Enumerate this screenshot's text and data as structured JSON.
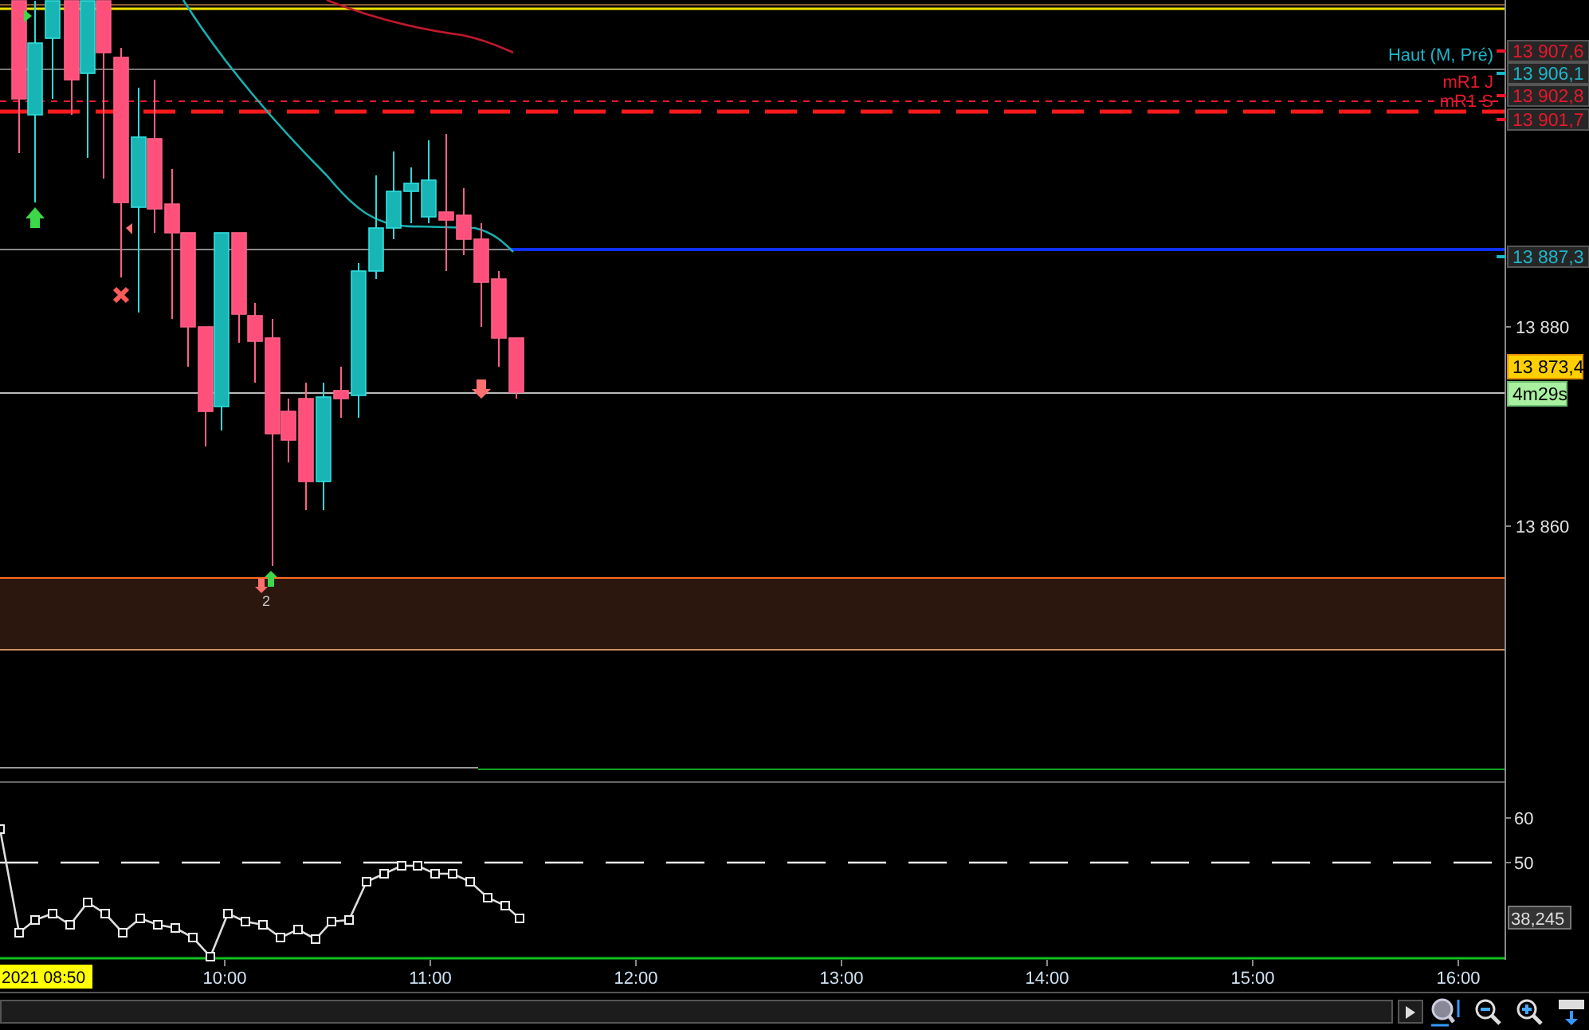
{
  "overlay_labels": [
    {
      "text": "Haut (M, Pré)",
      "color": "#1fb5c8"
    },
    {
      "text": "mR1 J",
      "color": "#e8182c"
    },
    {
      "text": "mR1 S",
      "color": "#e8182c"
    }
  ],
  "price_scale": {
    "ticks": [
      "13 880",
      "13 860"
    ],
    "markers": [
      {
        "text": "13 907,6",
        "color": "#e8182c"
      },
      {
        "text": "13 906,1",
        "color": "#1fb5c8"
      },
      {
        "text": "13 902,8",
        "color": "#e8182c"
      },
      {
        "text": "13 901,7",
        "color": "#e8182c"
      },
      {
        "text": "13 887,3",
        "color": "#1fb5c8"
      }
    ],
    "last_price": "13 873,4",
    "countdown": "4m29s"
  },
  "signal_count": "2",
  "oscillator": {
    "ticks": [
      "60",
      "50"
    ],
    "value": "38,245"
  },
  "time_axis": {
    "cursor_label": "2021 08:50",
    "ticks": [
      "10:00",
      "11:00",
      "12:00",
      "13:00",
      "14:00",
      "15:00",
      "16:00"
    ]
  }
}
